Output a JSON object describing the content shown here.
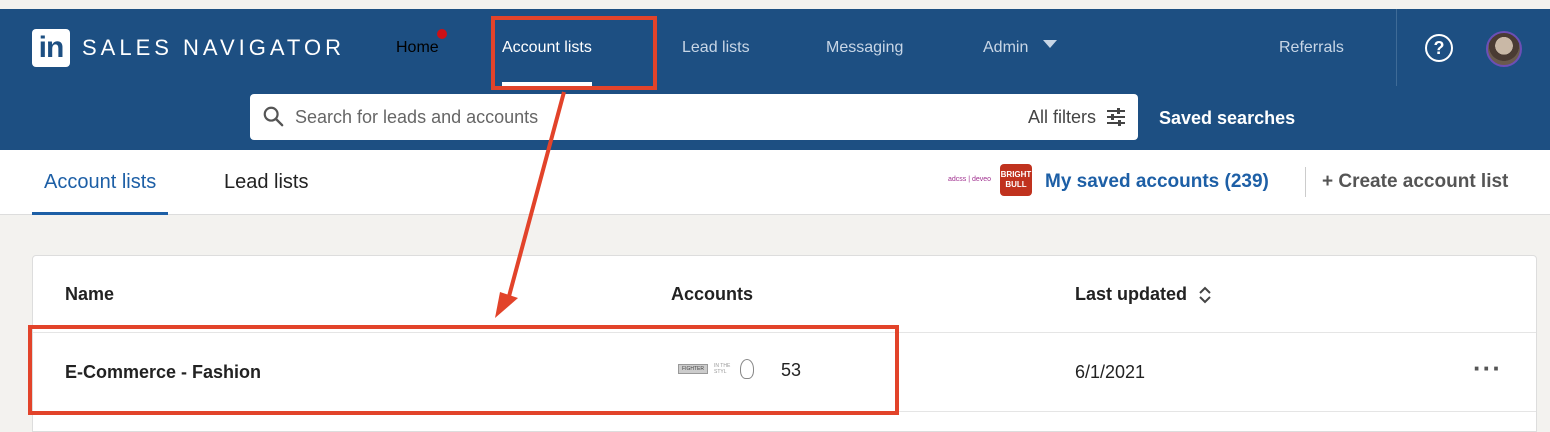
{
  "brand": {
    "logo": "in",
    "title": "SALES NAVIGATOR"
  },
  "nav": {
    "home": "Home",
    "account_lists": "Account lists",
    "lead_lists": "Lead lists",
    "messaging": "Messaging",
    "admin": "Admin",
    "referrals": "Referrals"
  },
  "search": {
    "placeholder": "Search for leads and accounts",
    "all_filters": "All filters",
    "saved_searches": "Saved searches"
  },
  "subtabs": {
    "account_lists": "Account lists",
    "lead_lists": "Lead lists",
    "saved_logo_text": "adcss | deveo",
    "saved_logo_red": "BRIGHT BULL",
    "my_saved_accounts": "My saved accounts (239)",
    "create_list": "+ Create account list"
  },
  "table": {
    "headers": {
      "name": "Name",
      "accounts": "Accounts",
      "last_updated": "Last updated"
    },
    "rows": [
      {
        "name": "E-Commerce - Fashion",
        "logo1": "FIGHTER",
        "logo2": "IN THE STYL",
        "accounts": "53",
        "last_updated": "6/1/2021",
        "more": "···"
      }
    ]
  },
  "colors": {
    "brand_blue": "#1d4f82",
    "link_blue": "#1d5fa6",
    "annotation_red": "#e2432a"
  }
}
